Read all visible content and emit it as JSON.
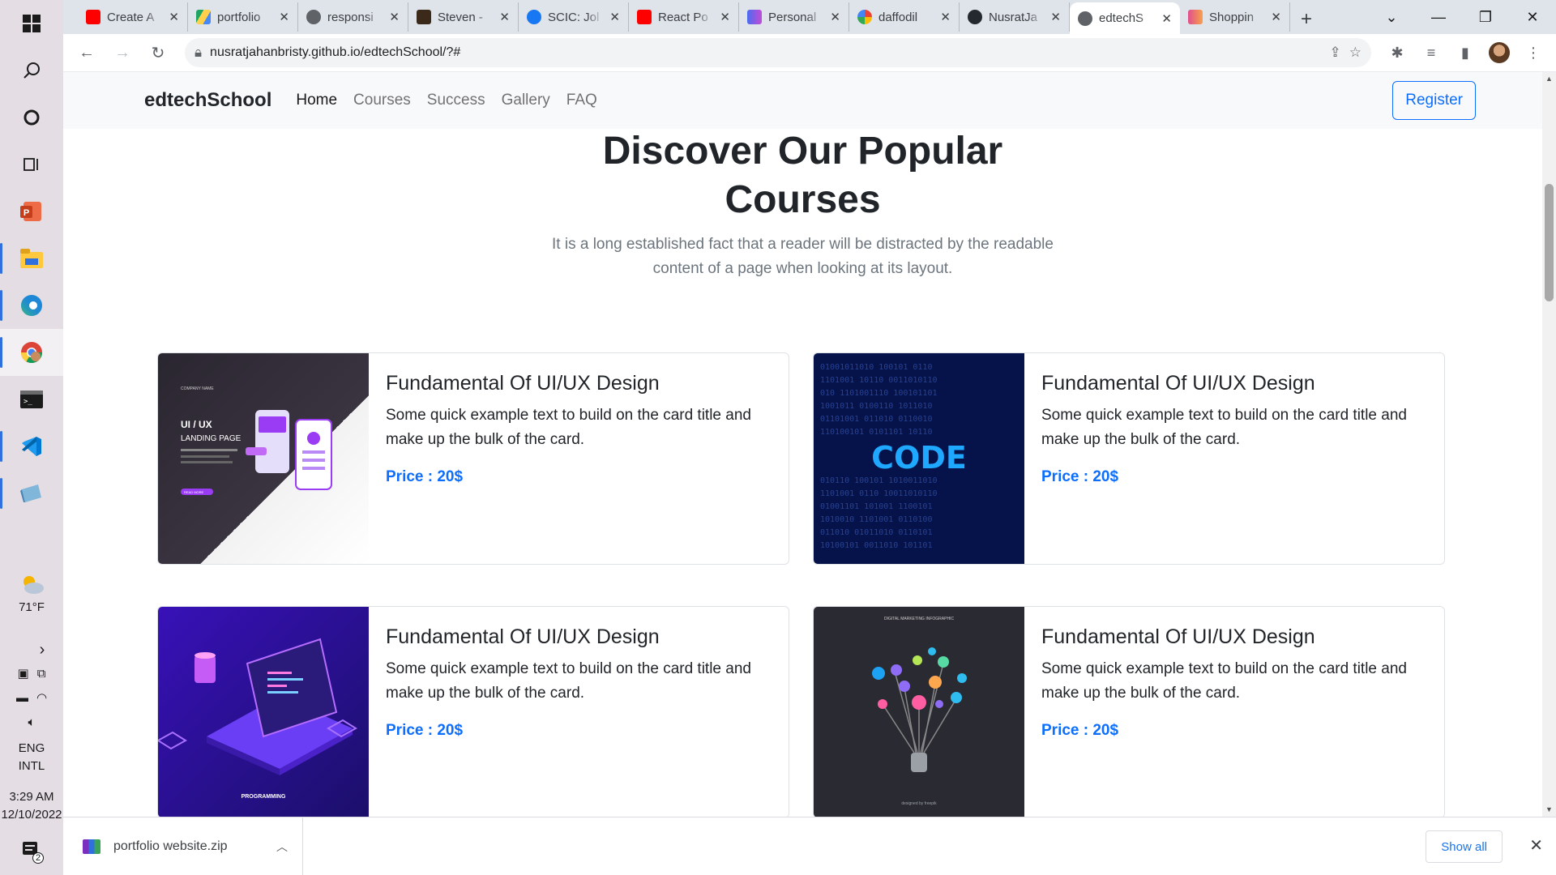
{
  "taskbar": {
    "items": [
      {
        "name": "windows-start-icon",
        "glyph": "⊞"
      },
      {
        "name": "search-icon",
        "glyph": "⌕"
      },
      {
        "name": "cortana-icon",
        "glyph": "○"
      },
      {
        "name": "task-view-icon",
        "glyph": "⧉"
      },
      {
        "name": "powerpoint-icon",
        "glyph": "P"
      },
      {
        "name": "file-explorer-icon",
        "glyph": "▤"
      },
      {
        "name": "edge-icon",
        "glyph": "e"
      },
      {
        "name": "chrome-icon",
        "glyph": "◉"
      },
      {
        "name": "terminal-icon",
        "glyph": "▬"
      },
      {
        "name": "vscode-icon",
        "glyph": "❯"
      },
      {
        "name": "app-icon",
        "glyph": "◧"
      }
    ],
    "weather": {
      "temp": "71°F"
    },
    "tray": {
      "language": "ENG",
      "layout": "INTL",
      "time": "3:29 AM",
      "date": "12/10/2022",
      "notification_count": "2"
    }
  },
  "browser": {
    "tabs": [
      {
        "title": "Create A",
        "favicon_color": "#ff0000"
      },
      {
        "title": "portfolio",
        "favicon_color": "#1fa463"
      },
      {
        "title": "responsi",
        "favicon_color": "#5f6368"
      },
      {
        "title": "Steven -",
        "favicon_color": "#3b2a1a"
      },
      {
        "title": "SCIC: Jol",
        "favicon_color": "#1877f2"
      },
      {
        "title": "React Po",
        "favicon_color": "#ff0000"
      },
      {
        "title": "Personal",
        "favicon_color": "#4b6cf0"
      },
      {
        "title": "daffodil",
        "favicon_color": "#4285f4"
      },
      {
        "title": "NusratJa",
        "favicon_color": "#24292f"
      },
      {
        "title": "edtechS",
        "favicon_color": "#5f6368",
        "active": true
      },
      {
        "title": "Shoppin",
        "favicon_color": "#e04f8d"
      }
    ],
    "url": "nusratjahanbristy.github.io/edtechSchool/?#"
  },
  "site": {
    "brand": "edtechSchool",
    "nav": [
      "Home",
      "Courses",
      "Success",
      "Gallery",
      "FAQ"
    ],
    "register_label": "Register",
    "heading": "Discover Our Popular Courses",
    "subtitle": "It is a long established fact that a reader will be distracted by the readable content of a page when looking at its layout.",
    "courses": [
      {
        "title": "Fundamental Of UI/UX Design",
        "text": "Some quick example text to build on the card title and make up the bulk of the card.",
        "price": "Price : 20$",
        "image": "ui-ux-landing-page",
        "image_caption": "UI / UX",
        "image_caption2": "LANDING PAGE",
        "image_company": "COMPANY NAME",
        "image_button": "READ MORE"
      },
      {
        "title": "Fundamental Of UI/UX Design",
        "text": "Some quick example text to build on the card title and make up the bulk of the card.",
        "price": "Price : 20$",
        "image": "code-binary",
        "image_caption": "CODE"
      },
      {
        "title": "Fundamental Of UI/UX Design",
        "text": "Some quick example text to build on the card title and make up the bulk of the card.",
        "price": "Price : 20$",
        "image": "programming-laptop",
        "image_caption": "PROGRAMMING"
      },
      {
        "title": "Fundamental Of UI/UX Design",
        "text": "Some quick example text to build on the card title and make up the bulk of the card.",
        "price": "Price : 20$",
        "image": "digital-marketing-infographic",
        "image_caption": "DIGITAL MARKETING INFOGRAPHIC",
        "image_credit": "designed by freepik"
      }
    ]
  },
  "downloads": {
    "file": "portfolio website.zip",
    "show_all": "Show all"
  },
  "colors": {
    "accent": "#0d6efd",
    "navbar_bg": "#f8f9fa",
    "muted_text": "#6c757d"
  }
}
